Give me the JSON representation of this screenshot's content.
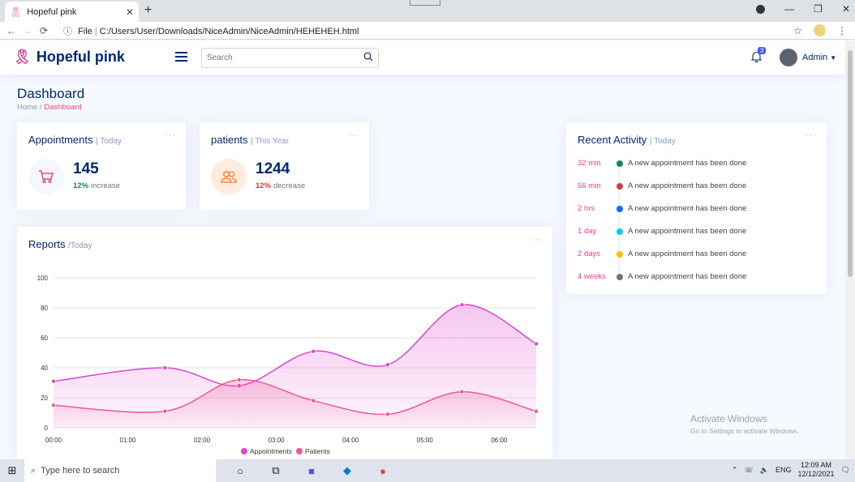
{
  "browser": {
    "tab_title": "Hopeful pink",
    "url_prefix": "File",
    "url": "C:/Users/User/Downloads/NiceAdmin/NiceAdmin/HEHEHEH.html"
  },
  "header": {
    "brand": "Hopeful pink",
    "search_placeholder": "Search",
    "notifications_count": "3",
    "user_name": "Admin"
  },
  "page": {
    "title": "Dashboard",
    "breadcrumb": [
      "Home",
      "Dashboard"
    ]
  },
  "cards": {
    "appointments": {
      "title": "Appointments",
      "period": "| Today",
      "value": "145",
      "pct": "12%",
      "trend": "increase",
      "trend_color": "#198754"
    },
    "patients": {
      "title": "patients",
      "period": "| This Year",
      "value": "1244",
      "pct": "12%",
      "trend": "decrease",
      "trend_color": "#dc3545"
    }
  },
  "activity": {
    "title": "Recent Activity",
    "period": "| Today",
    "items": [
      {
        "time": "32 min",
        "text": "A new appointment has been done",
        "color": "#198754"
      },
      {
        "time": "56 min",
        "text": "A new appointment has been done",
        "color": "#dc3545"
      },
      {
        "time": "2 hrs",
        "text": "A new appointment has been done",
        "color": "#0d6efd"
      },
      {
        "time": "1 day",
        "text": "A new appointment has been done",
        "color": "#0dcaf0"
      },
      {
        "time": "2 days",
        "text": "A new appointment has been done",
        "color": "#ffc107"
      },
      {
        "time": "4 weeks",
        "text": "A new appointment has been done",
        "color": "#6c757d"
      }
    ]
  },
  "reports": {
    "title": "Reports",
    "period": "/Today"
  },
  "chart_data": {
    "type": "area",
    "x": [
      "00:00",
      "01:00",
      "02:00",
      "03:00",
      "04:00",
      "05:00",
      "06:00"
    ],
    "point_x": [
      0,
      1.5,
      2.5,
      3.5,
      4.5,
      5.5,
      6.5
    ],
    "ylim": [
      0,
      100
    ],
    "yticks": [
      0,
      20,
      40,
      60,
      80,
      100
    ],
    "series": [
      {
        "name": "Appointments",
        "color": "#dd44cc",
        "values": [
          31,
          40,
          28,
          51,
          42,
          82,
          56
        ]
      },
      {
        "name": "Patients",
        "color": "#ee5599",
        "values": [
          15,
          11,
          32,
          18,
          9,
          24,
          11
        ]
      }
    ],
    "legend": "bottom"
  },
  "windows": {
    "activate_title": "Activate Windows",
    "activate_sub": "Go to Settings to activate Windows."
  },
  "taskbar": {
    "search_placeholder": "Type here to search",
    "lang": "ENG",
    "time": "12:09 AM",
    "date": "12/12/2021",
    "notif_count": "3"
  }
}
